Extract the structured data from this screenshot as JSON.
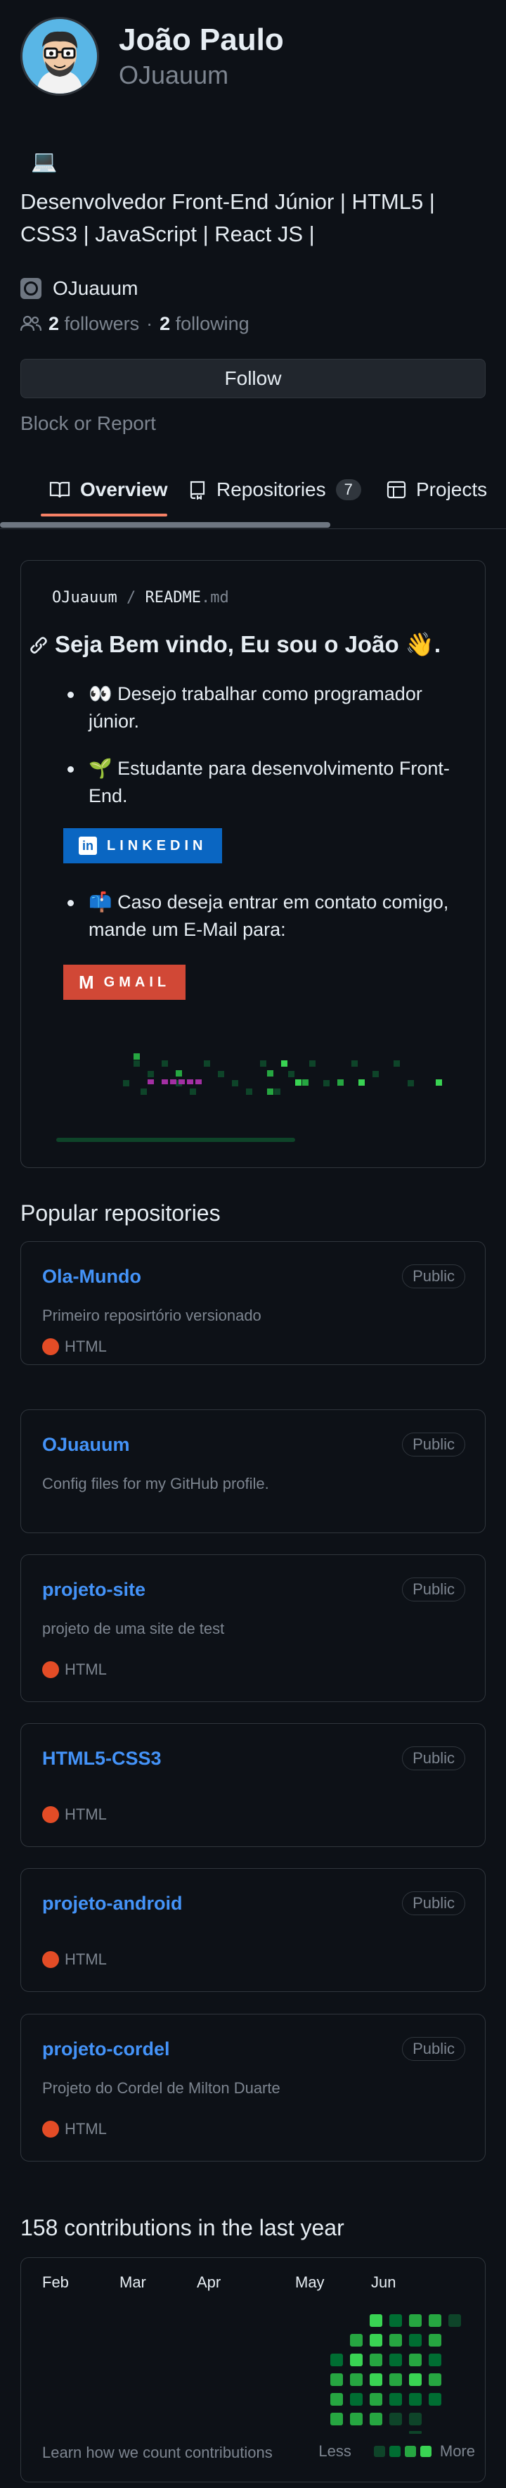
{
  "profile": {
    "name": "João Paulo",
    "login": "OJuauum",
    "status_emoji": "💻",
    "bio": "Desenvolvedor Front-End Júnior | HTML5 | CSS3 | JavaScript | React JS |",
    "company": "OJuauum",
    "followers_count": "2",
    "followers_label": "followers",
    "separator": "·",
    "following_count": "2",
    "following_label": "following",
    "follow_button": "Follow",
    "block_link": "Block or Report"
  },
  "tabs": [
    {
      "label": "Overview",
      "icon": "book-icon",
      "active": true
    },
    {
      "label": "Repositories",
      "icon": "repo-icon",
      "count": "7"
    },
    {
      "label": "Projects",
      "icon": "table-icon"
    }
  ],
  "readme": {
    "path_user": "OJuauum",
    "path_sep": "/",
    "path_file": "README",
    "path_ext": ".md",
    "title": "Seja Bem vindo, Eu sou o João 👋.",
    "items": [
      "👀 Desejo trabalhar como programador júnior.",
      "🌱 Estudante para desenvolvimento Front-End.",
      "📫 Caso deseja entrar em contato comigo, mande um E-Mail para:"
    ],
    "linkedin_badge": "LINKEDIN",
    "gmail_badge": "GMAIL",
    "linkedin_color": "#0a66c2",
    "gmail_color": "#d14836"
  },
  "popular": {
    "title": "Popular repositories",
    "repos": [
      {
        "name": "Ola-Mundo",
        "visibility": "Public",
        "description": "Primeiro reposirtório versionado",
        "language": "HTML"
      },
      {
        "name": "OJuauum",
        "visibility": "Public",
        "description": "Config files for my GitHub profile.",
        "language": ""
      },
      {
        "name": "projeto-site",
        "visibility": "Public",
        "description": "projeto de uma site de test",
        "language": "HTML"
      },
      {
        "name": "HTML5-CSS3",
        "visibility": "Public",
        "description": "",
        "language": "HTML"
      },
      {
        "name": "projeto-android",
        "visibility": "Public",
        "description": "",
        "language": "HTML"
      },
      {
        "name": "projeto-cordel",
        "visibility": "Public",
        "description": "Projeto do Cordel de Milton Duarte",
        "language": "HTML"
      }
    ],
    "language_color": "#e34c26"
  },
  "contributions": {
    "title": "158 contributions in the last year",
    "months": [
      "Feb",
      "Mar",
      "Apr",
      "May",
      "Jun"
    ],
    "footer_link": "Learn how we count contributions",
    "legend_less": "Less",
    "legend_more": "More",
    "level_colors": [
      "#161b22",
      "#0e4429",
      "#006d32",
      "#26a641",
      "#39d353"
    ]
  },
  "colors": {
    "background": "#0d1117",
    "link": "#4493f8",
    "tab_underline": "#f78166",
    "muted": "#7d8590"
  }
}
